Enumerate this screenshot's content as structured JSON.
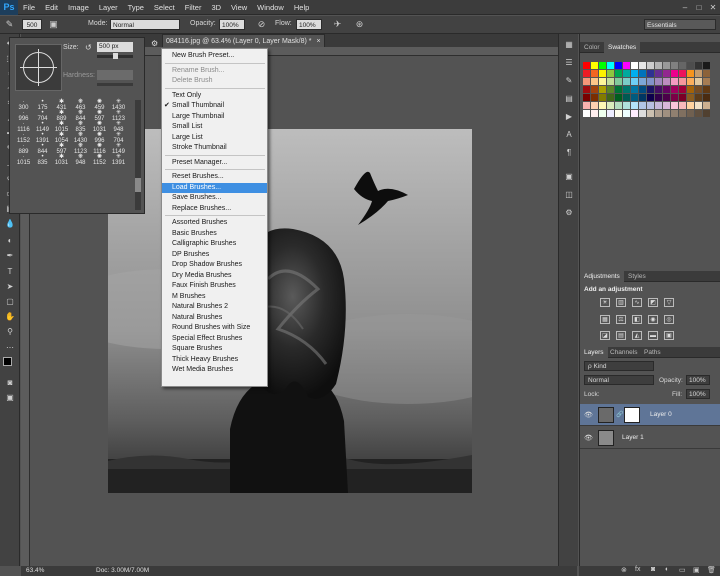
{
  "app": {
    "logo": "Ps"
  },
  "menubar": {
    "items": [
      "File",
      "Edit",
      "Image",
      "Layer",
      "Type",
      "Select",
      "Filter",
      "3D",
      "View",
      "Window",
      "Help"
    ],
    "window_controls": [
      "–",
      "□",
      "✕"
    ]
  },
  "options": {
    "brush_size": "500",
    "mode_label": "Mode:",
    "mode_value": "Normal",
    "opacity_label": "Opacity:",
    "opacity_value": "100%",
    "flow_label": "Flow:",
    "flow_value": "100%",
    "workspace": "Essentials"
  },
  "document": {
    "tab_title": "084116.jpg @ 63.4% (Layer 0, Layer Mask/8) *",
    "zoom": "63.4%",
    "doc_size": "Doc: 3.00M/7.00M"
  },
  "brush_picker": {
    "size_label": "Size:",
    "size_value": "500 px",
    "hardness_label": "Hardness:",
    "brushes": [
      "300",
      "175",
      "431",
      "463",
      "459",
      "1430",
      "996",
      "704",
      "889",
      "844",
      "597",
      "1123",
      "1116",
      "1149",
      "1015",
      "835",
      "1031",
      "948",
      "1152",
      "1391",
      "1054",
      "1430",
      "996",
      "704",
      "889",
      "844",
      "597",
      "1123",
      "1116",
      "1149",
      "1015",
      "835",
      "1031",
      "948",
      "1152",
      "1391"
    ]
  },
  "dropdown": {
    "groups": [
      [
        {
          "label": "New Brush Preset...",
          "enabled": true
        }
      ],
      [
        {
          "label": "Rename Brush...",
          "enabled": false
        },
        {
          "label": "Delete Brush",
          "enabled": false
        }
      ],
      [
        {
          "label": "Text Only",
          "enabled": true
        },
        {
          "label": "Small Thumbnail",
          "enabled": true,
          "checked": true
        },
        {
          "label": "Large Thumbnail",
          "enabled": true
        },
        {
          "label": "Small List",
          "enabled": true
        },
        {
          "label": "Large List",
          "enabled": true
        },
        {
          "label": "Stroke Thumbnail",
          "enabled": true
        }
      ],
      [
        {
          "label": "Preset Manager...",
          "enabled": true
        }
      ],
      [
        {
          "label": "Reset Brushes...",
          "enabled": true
        },
        {
          "label": "Load Brushes...",
          "enabled": true,
          "highlighted": true
        },
        {
          "label": "Save Brushes...",
          "enabled": true
        },
        {
          "label": "Replace Brushes...",
          "enabled": true
        }
      ],
      [
        {
          "label": "Assorted Brushes",
          "enabled": true
        },
        {
          "label": "Basic Brushes",
          "enabled": true
        },
        {
          "label": "Calligraphic Brushes",
          "enabled": true
        },
        {
          "label": "DP Brushes",
          "enabled": true
        },
        {
          "label": "Drop Shadow Brushes",
          "enabled": true
        },
        {
          "label": "Dry Media Brushes",
          "enabled": true
        },
        {
          "label": "Faux Finish Brushes",
          "enabled": true
        },
        {
          "label": "M Brushes",
          "enabled": true
        },
        {
          "label": "Natural Brushes 2",
          "enabled": true
        },
        {
          "label": "Natural Brushes",
          "enabled": true
        },
        {
          "label": "Round Brushes with Size",
          "enabled": true
        },
        {
          "label": "Special Effect Brushes",
          "enabled": true
        },
        {
          "label": "Square Brushes",
          "enabled": true
        },
        {
          "label": "Thick Heavy Brushes",
          "enabled": true
        },
        {
          "label": "Wet Media Brushes",
          "enabled": true
        }
      ]
    ]
  },
  "panels": {
    "color_tabs": [
      "Color",
      "Swatches"
    ],
    "adjustment_tabs": [
      "Adjustments",
      "Styles"
    ],
    "adjustment_title": "Add an adjustment",
    "layers_tabs": [
      "Layers",
      "Channels",
      "Paths"
    ],
    "kind_label": "ρ Kind",
    "blend_mode": "Normal",
    "opacity_label": "Opacity:",
    "opacity_value": "100%",
    "lock_label": "Lock:",
    "fill_label": "Fill:",
    "fill_value": "100%",
    "layers": [
      {
        "name": "Layer 0",
        "selected": true,
        "has_mask": true
      },
      {
        "name": "Layer 1",
        "selected": false,
        "has_mask": false
      }
    ]
  },
  "colors": {
    "highlight": "#3e8fe2",
    "selected_layer": "#5f7597"
  }
}
